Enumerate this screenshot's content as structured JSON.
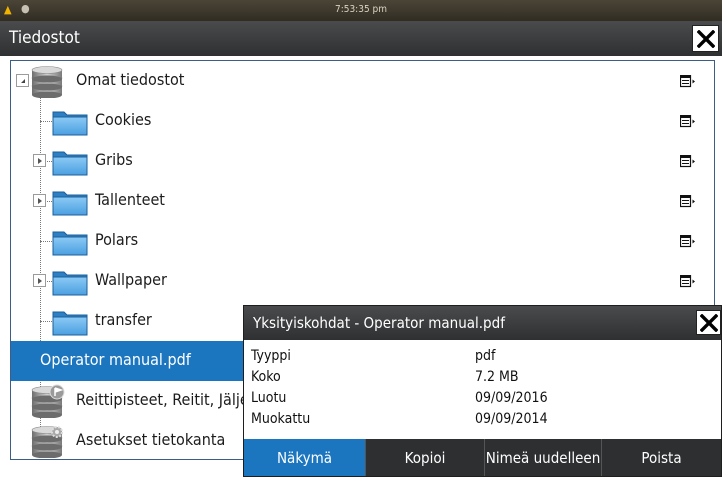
{
  "status": {
    "time": "7:53:35 pm"
  },
  "window": {
    "title": "Tiedostot"
  },
  "tree": [
    {
      "label": "Omat tiedostot",
      "kind": "database",
      "expander": "expanded",
      "menu": true
    },
    {
      "label": "Cookies",
      "kind": "folder",
      "expander": null,
      "menu": true
    },
    {
      "label": "Gribs",
      "kind": "folder",
      "expander": "collapsed",
      "menu": true
    },
    {
      "label": "Tallenteet",
      "kind": "folder",
      "expander": "collapsed",
      "menu": true
    },
    {
      "label": "Polars",
      "kind": "folder",
      "expander": null,
      "menu": true
    },
    {
      "label": "Wallpaper",
      "kind": "folder",
      "expander": "collapsed",
      "menu": true
    },
    {
      "label": "transfer",
      "kind": "folder",
      "expander": null,
      "menu": false
    },
    {
      "label": "Operator manual.pdf",
      "kind": "file",
      "expander": null,
      "menu": false,
      "selected": true
    },
    {
      "label": "Reittipisteet, Reitit, Jäljet",
      "kind": "database-flag",
      "expander": null,
      "menu": false
    },
    {
      "label": "Asetukset tietokanta",
      "kind": "database-gear",
      "expander": null,
      "menu": false
    }
  ],
  "details": {
    "title": "Yksityiskohdat - Operator manual.pdf",
    "properties": [
      {
        "key": "Tyyppi",
        "value": "pdf"
      },
      {
        "key": "Koko",
        "value": "7.2 MB"
      },
      {
        "key": "Luotu",
        "value": "09/09/2016"
      },
      {
        "key": "Muokattu",
        "value": "09/09/2014"
      }
    ],
    "buttons": [
      {
        "label": "Näkymä",
        "active": true
      },
      {
        "label": "Kopioi",
        "active": false
      },
      {
        "label": "Nimeä uudelleen",
        "active": false
      },
      {
        "label": "Poista",
        "active": false
      }
    ]
  },
  "colors": {
    "accent": "#1b76bf",
    "titlebar": "#3b3c3d",
    "folder": "#4a9fe0"
  }
}
